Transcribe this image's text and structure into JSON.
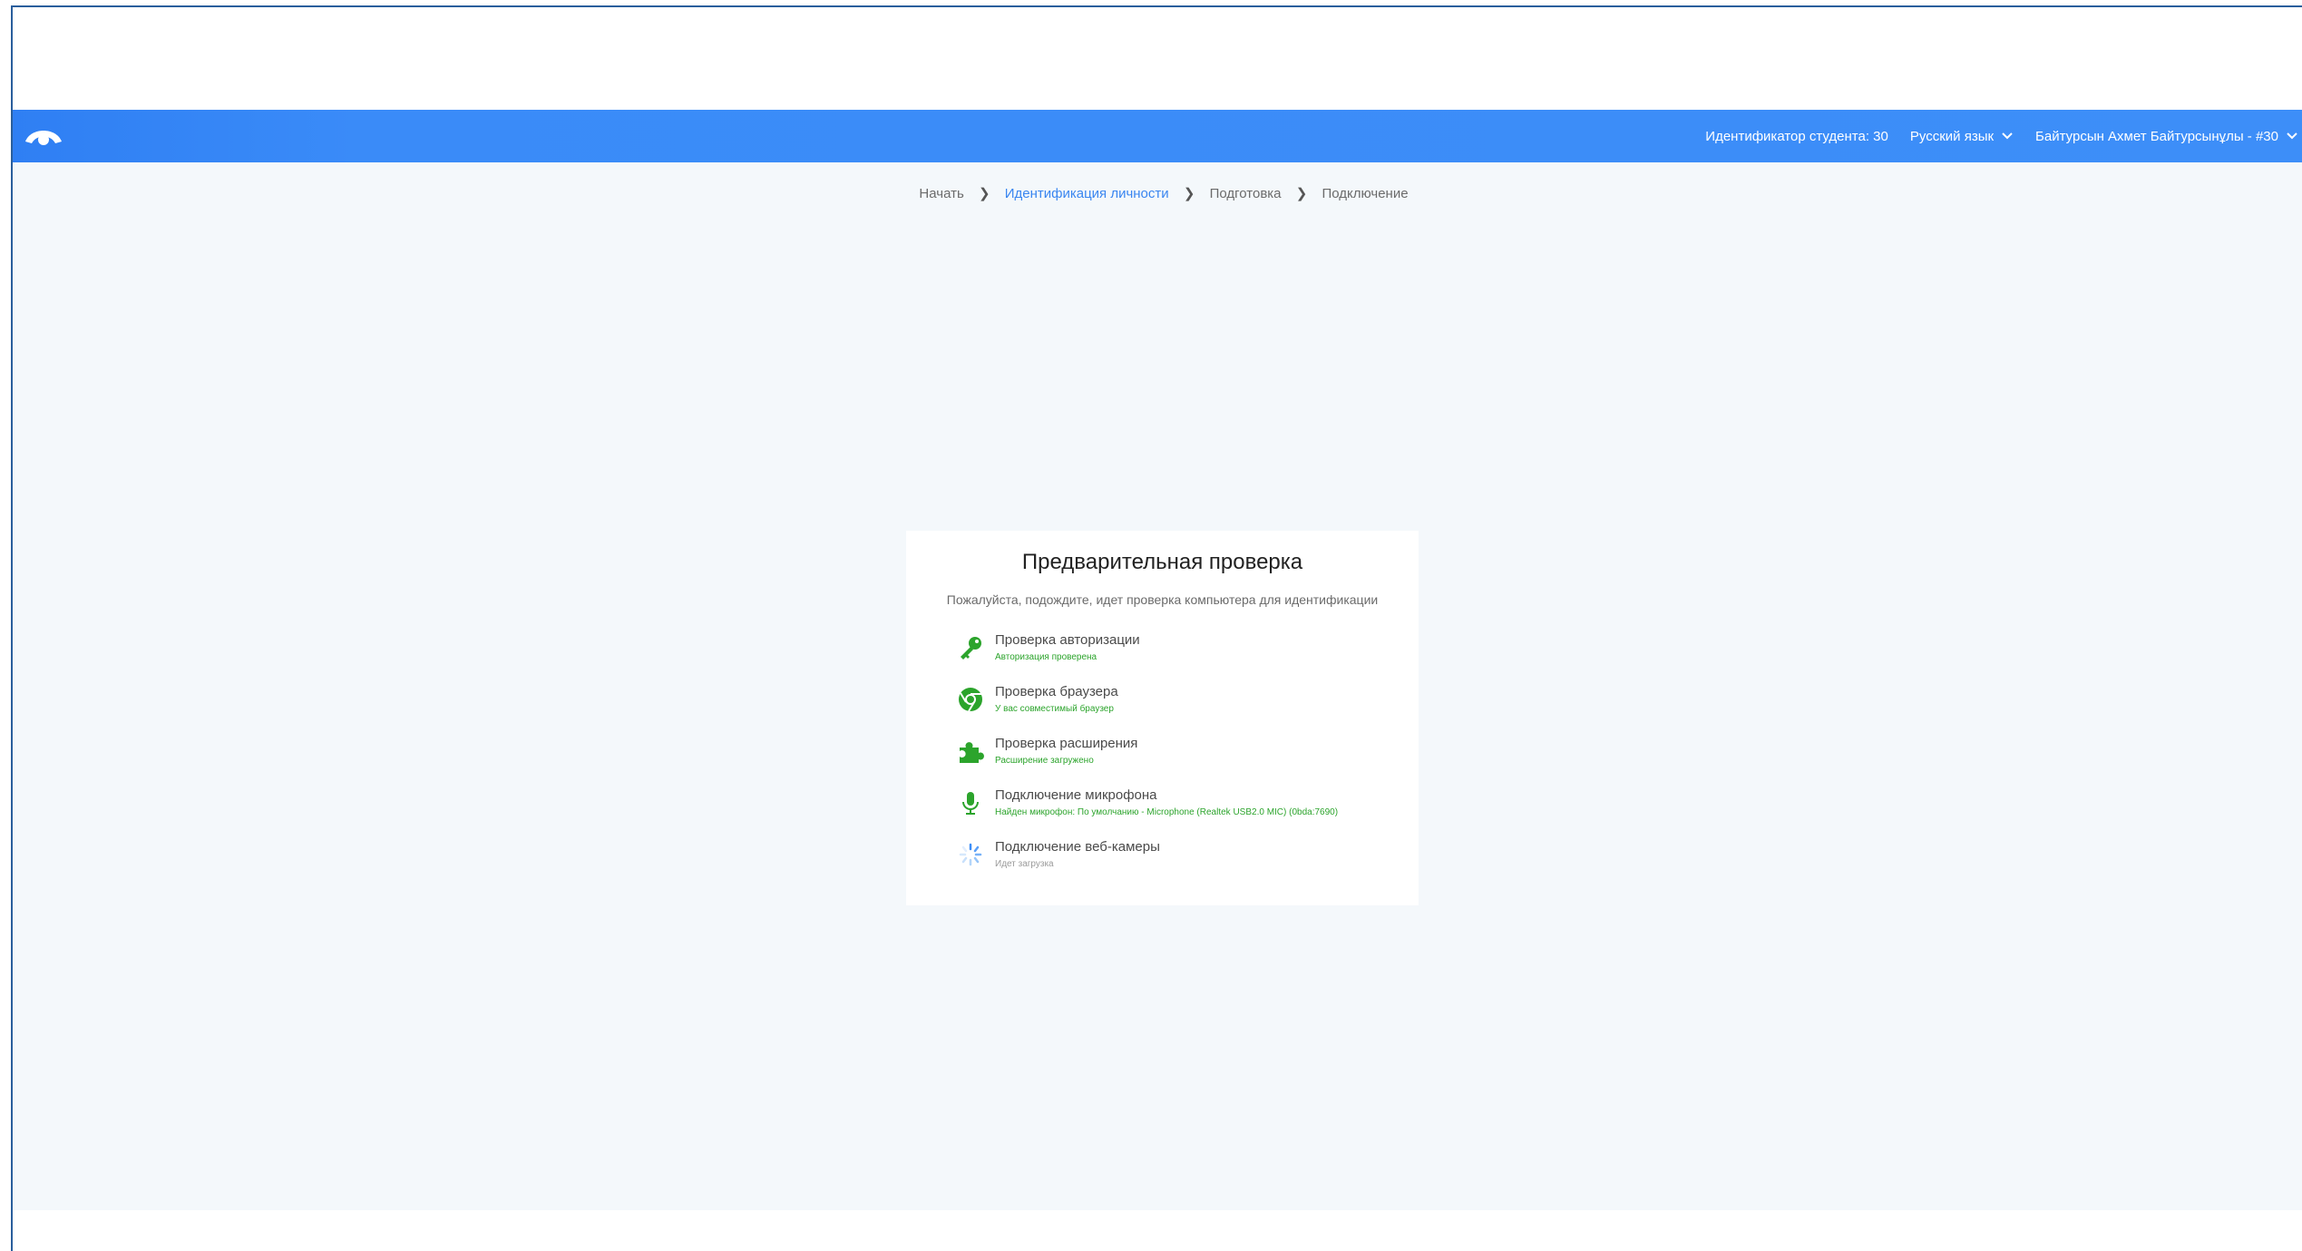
{
  "header": {
    "student_id": "Идентификатор студента: 30",
    "language": "Русский язык",
    "user": "Байтурсын Ахмет Байтурсынұлы - #30",
    "logo_icon": "eye-logo-icon",
    "chevron_icon": "chevron-down-icon"
  },
  "breadcrumb": {
    "items": [
      "Начать",
      "Идентификация личности",
      "Подготовка",
      "Подключение"
    ],
    "active_index": 1
  },
  "card": {
    "title": "Предварительная проверка",
    "subtitle": "Пожалуйста, подождите, идет проверка компьютера для идентификации",
    "checks": [
      {
        "title": "Проверка авторизации",
        "status": "Авторизация проверена",
        "icon": "key-icon",
        "state": "ok"
      },
      {
        "title": "Проверка браузера",
        "status": "У вас совместимый браузер",
        "icon": "chrome-icon",
        "state": "ok"
      },
      {
        "title": "Проверка расширения",
        "status": "Расширение загружено",
        "icon": "puzzle-icon",
        "state": "ok"
      },
      {
        "title": "Подключение микрофона",
        "status": "Найден микрофон: По умолчанию - Microphone (Realtek USB2.0 MIC) (0bda:7690)",
        "icon": "microphone-icon",
        "state": "ok"
      },
      {
        "title": "Подключение веб-камеры",
        "status": "Идет загрузка",
        "icon": "spinner-icon",
        "state": "loading"
      }
    ]
  },
  "colors": {
    "accent": "#3d8ef8",
    "success": "#2ca42c",
    "background": "#f4f8fb"
  }
}
